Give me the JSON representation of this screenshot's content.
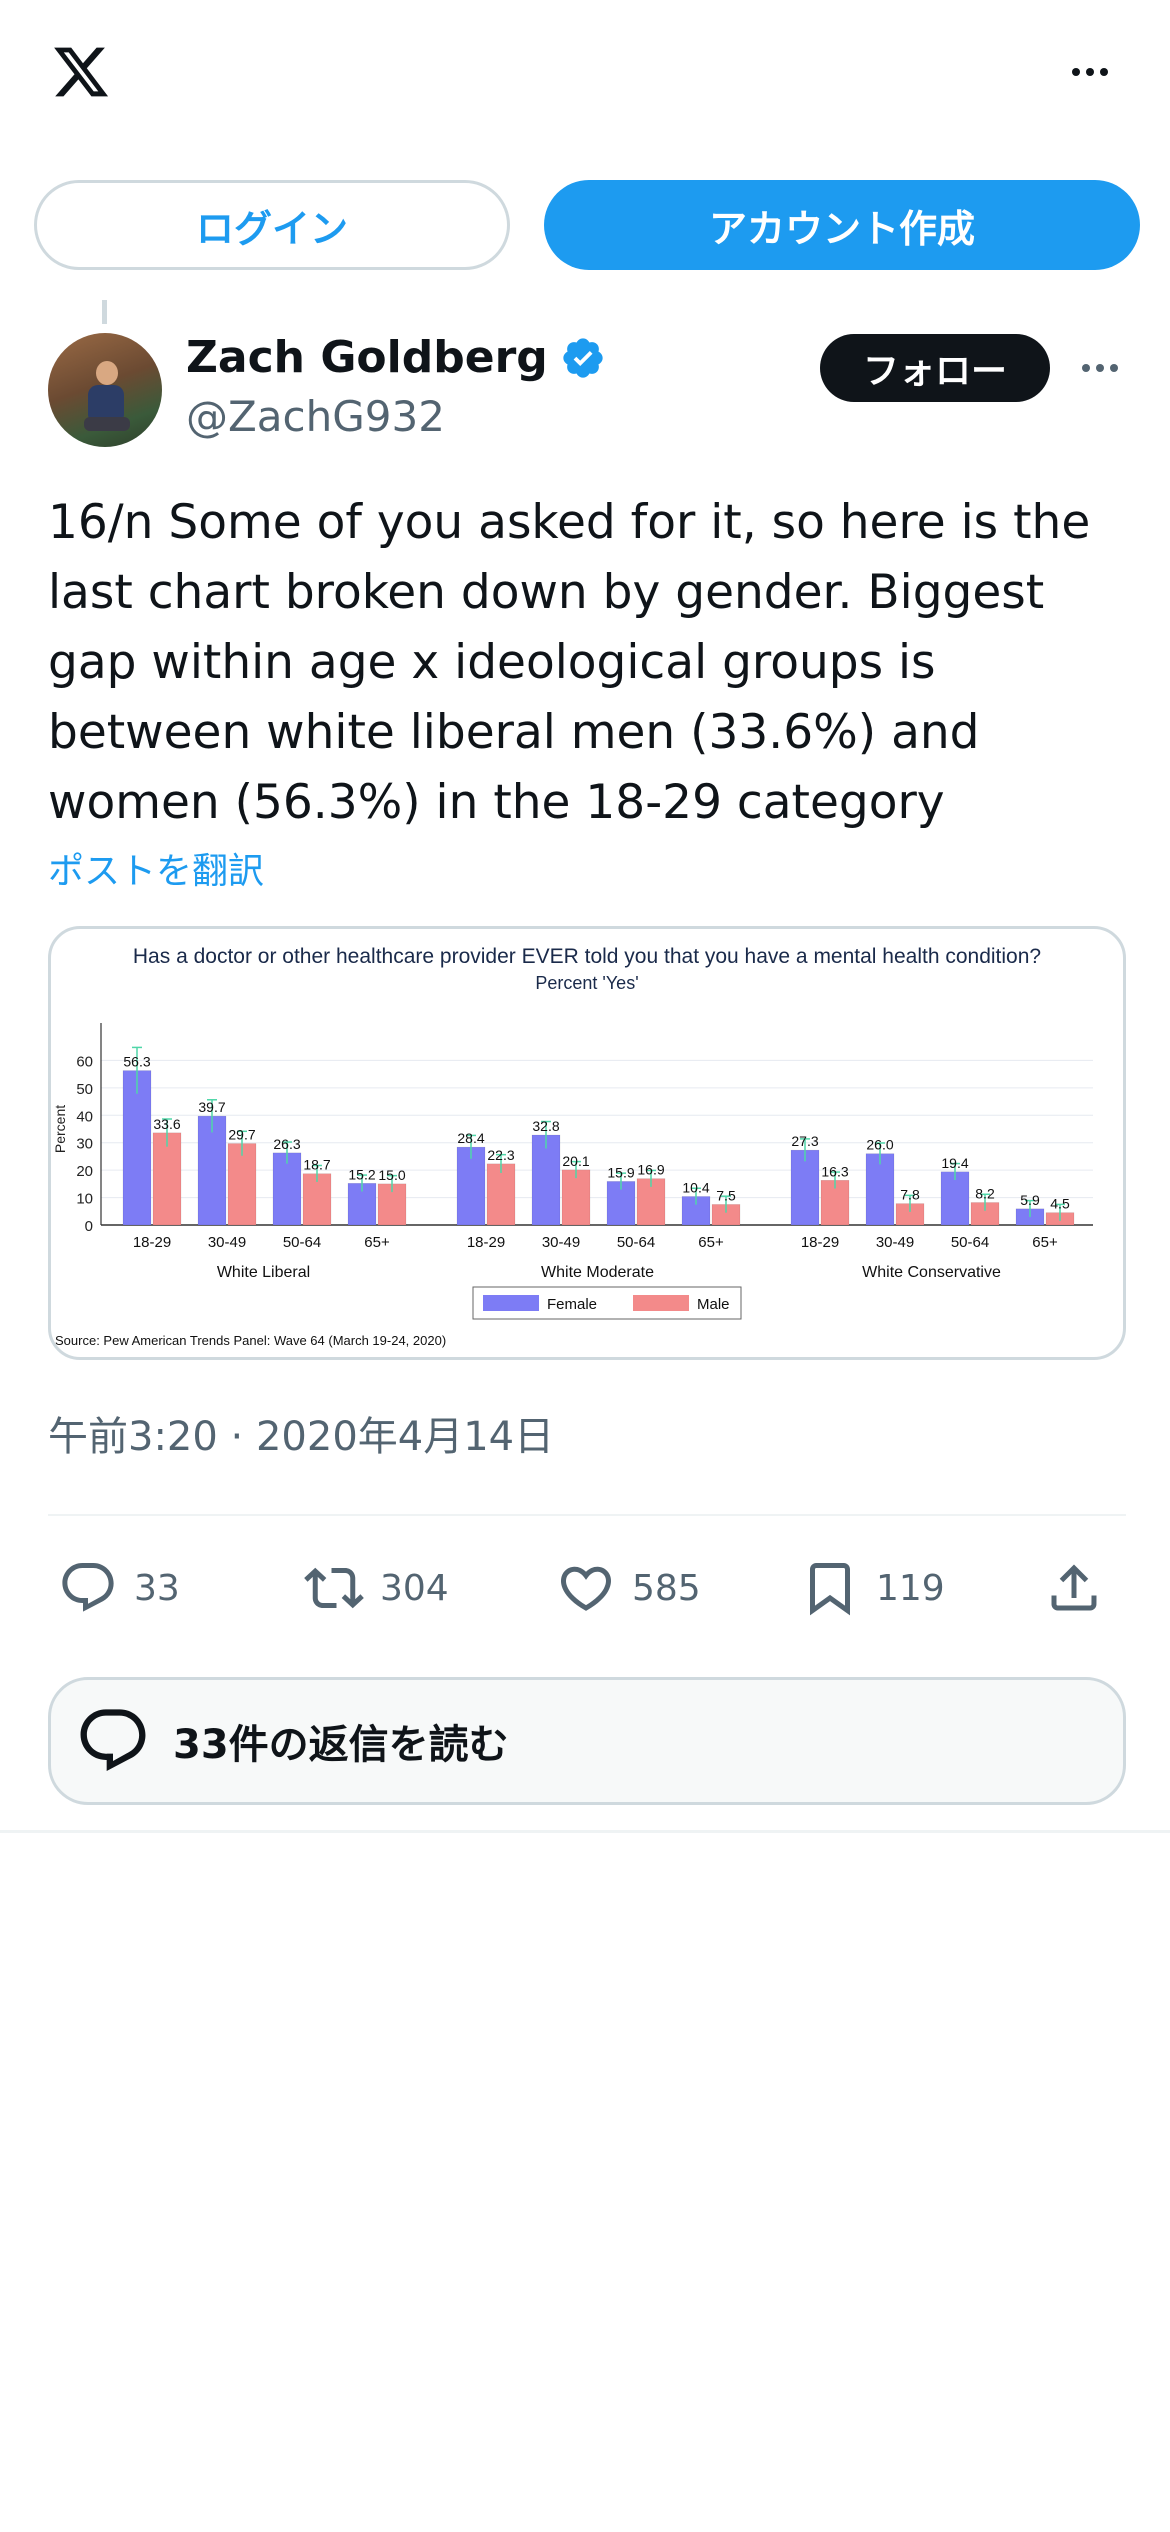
{
  "header": {
    "logo": "x-logo-icon",
    "more": "more-icon"
  },
  "auth": {
    "login_label": "ログイン",
    "signup_label": "アカウント作成"
  },
  "tweet": {
    "author_name": "Zach Goldberg",
    "handle": "@ZachG932",
    "follow_label": "フォロー",
    "text_lines": [
      "16/n Some of you asked for it, so here is the",
      "last chart broken down by gender. Biggest",
      "gap within age x ideological groups is",
      "between white liberal men (33.6%) and",
      "women (56.3%)  in the 18-29 category"
    ],
    "translate_label": "ポストを翻訳",
    "timestamp": "午前3:20 · 2020年4月14日",
    "stats": {
      "replies": "33",
      "reposts": "304",
      "likes": "585",
      "bookmarks": "119"
    },
    "read_replies_label": "33件の返信を読む"
  },
  "colors": {
    "accent": "#1d9bf0",
    "text": "#0f1419",
    "muted": "#536471",
    "female": "#7d7cf5",
    "male": "#f38a8a"
  },
  "chart_data": {
    "type": "bar",
    "title": "Has a doctor or other healthcare provider EVER told you that you have a mental health condition?",
    "subtitle": "Percent 'Yes'",
    "ylabel": "Percent",
    "ylim": [
      0,
      70
    ],
    "yticks": [
      0,
      10,
      20,
      30,
      40,
      50,
      60
    ],
    "groups": [
      "White Liberal",
      "White Moderate",
      "White Conservative"
    ],
    "categories": [
      "18-29",
      "30-49",
      "50-64",
      "65+"
    ],
    "series": [
      {
        "name": "Female",
        "values": [
          [
            56.3,
            39.7,
            26.3,
            15.2
          ],
          [
            28.4,
            32.8,
            15.9,
            10.4
          ],
          [
            27.3,
            26.0,
            19.4,
            5.9
          ]
        ]
      },
      {
        "name": "Male",
        "values": [
          [
            33.6,
            29.7,
            18.7,
            15.0
          ],
          [
            22.3,
            20.1,
            16.9,
            7.5
          ],
          [
            16.3,
            7.8,
            8.2,
            4.5
          ]
        ]
      }
    ],
    "data_labels": [
      [
        [
          "56.3",
          "39.7",
          "26.3",
          "15.2"
        ],
        [
          "28.4",
          "32.8",
          "15.9",
          "10.4"
        ],
        [
          "27.3",
          "26.0",
          "19.4",
          "5.9"
        ]
      ],
      [
        [
          "33.6",
          "29.7",
          "18.7",
          "15.0"
        ],
        [
          "22.3",
          "20.1",
          "16.9",
          "7.5"
        ],
        [
          "16.3",
          "7.8",
          "8.2",
          "4.5"
        ]
      ]
    ],
    "legend": {
      "position": "bottom-center",
      "entries": [
        "Female",
        "Male"
      ]
    },
    "source": "Source: Pew American Trends Panel: Wave 64 (March 19-24, 2020)",
    "error_bars": true
  }
}
